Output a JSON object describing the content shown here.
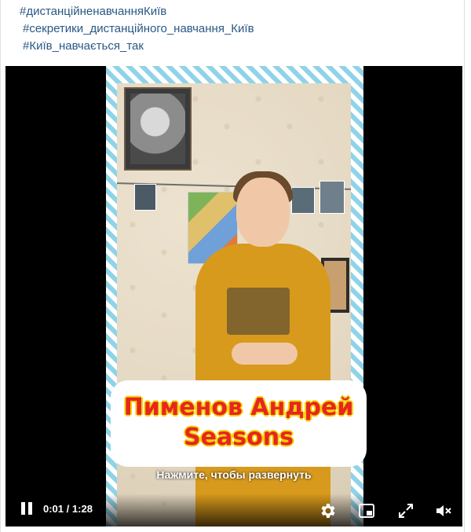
{
  "post": {
    "hashtags": [
      "#дистанційненавчанняКиїв",
      "#секретики_дистанційного_навчання_Київ",
      "#Київ_навчається_так"
    ]
  },
  "video": {
    "title_lines": [
      "Пименов Андрей",
      "Seasons"
    ],
    "expand_hint": "Нажмите, чтобы развернуть",
    "current_time": "0:01",
    "time_separator": "/",
    "duration": "1:28",
    "progress_fraction": 0.011,
    "frame_stripe_color": "#8fd3e8",
    "title_text_color": "#e6261f",
    "title_outline_color": "#f5d20a"
  },
  "controls": {
    "pause_icon": "pause-icon",
    "settings_icon": "gear-icon",
    "pip_icon": "picture-in-picture-icon",
    "fullscreen_icon": "fullscreen-icon",
    "mute_icon": "speaker-muted-icon"
  },
  "colors": {
    "link": "#2a5885",
    "video_bg": "#000000"
  }
}
